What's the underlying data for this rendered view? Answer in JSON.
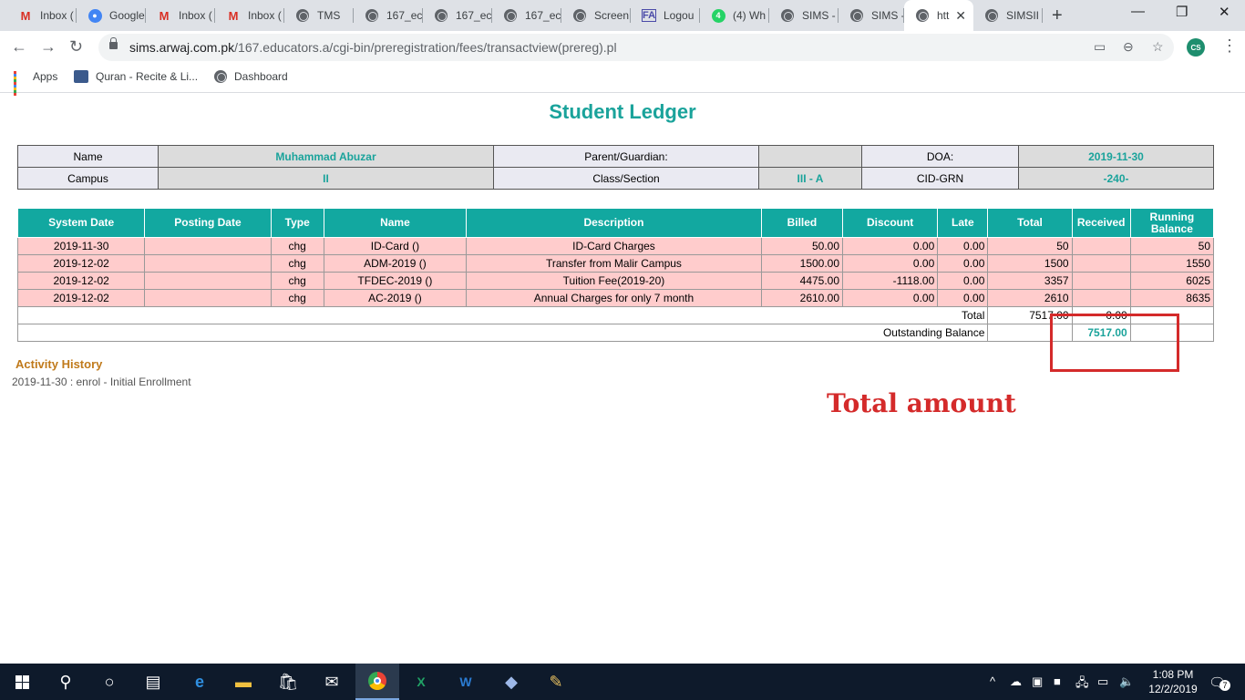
{
  "browser": {
    "tabs": [
      {
        "label": "Inbox (",
        "icon": "gmail-icon"
      },
      {
        "label": "Google",
        "icon": "google-account-icon"
      },
      {
        "label": "Inbox (",
        "icon": "gmail-icon"
      },
      {
        "label": "Inbox (",
        "icon": "gmail-icon"
      },
      {
        "label": "TMS",
        "icon": "globe-icon"
      },
      {
        "label": "167_ec",
        "icon": "globe-icon"
      },
      {
        "label": "167_ec",
        "icon": "globe-icon"
      },
      {
        "label": "167_ec",
        "icon": "globe-icon"
      },
      {
        "label": "Screen",
        "icon": "globe-icon"
      },
      {
        "label": "Logou",
        "icon": "logo-icon"
      },
      {
        "label": "(4) Wh",
        "icon": "whatsapp-icon"
      },
      {
        "label": "SIMS -",
        "icon": "globe-icon"
      },
      {
        "label": "SIMS -",
        "icon": "globe-icon"
      },
      {
        "label": "htt",
        "icon": "globe-icon"
      },
      {
        "label": "SIMSII",
        "icon": "globe-icon"
      }
    ],
    "url_domain": "sims.arwaj.com.pk",
    "url_path": "/167.educators.a/cgi-bin/preregistration/fees/transactview(prereg).pl",
    "profile_initials": "CS",
    "bookmarks": {
      "apps": "Apps",
      "quran": "Quran - Recite & Li...",
      "dashboard": "Dashboard"
    }
  },
  "page": {
    "title": "Student Ledger",
    "info": {
      "name_label": "Name",
      "name_value": "Muhammad Abuzar",
      "parent_label": "Parent/Guardian:",
      "parent_value": "",
      "doa_label": "DOA:",
      "doa_value": "2019-11-30",
      "campus_label": "Campus",
      "campus_value": "II",
      "class_label": "Class/Section",
      "class_value": "III - A",
      "cid_label": "CID-GRN",
      "cid_value": "-240-"
    },
    "ledger": {
      "headers": [
        "System Date",
        "Posting Date",
        "Type",
        "Name",
        "Description",
        "Billed",
        "Discount",
        "Late",
        "Total",
        "Received",
        "Running Balance"
      ],
      "rows": [
        {
          "system_date": "2019-11-30",
          "posting_date": "",
          "type": "chg",
          "name": "ID-Card ()",
          "description": "ID-Card Charges",
          "billed": "50.00",
          "discount": "0.00",
          "late": "0.00",
          "total": "50",
          "received": "",
          "running": "50"
        },
        {
          "system_date": "2019-12-02",
          "posting_date": "",
          "type": "chg",
          "name": "ADM-2019 ()",
          "description": "Transfer from Malir Campus",
          "billed": "1500.00",
          "discount": "0.00",
          "late": "0.00",
          "total": "1500",
          "received": "",
          "running": "1550"
        },
        {
          "system_date": "2019-12-02",
          "posting_date": "",
          "type": "chg",
          "name": "TFDEC-2019 ()",
          "description": "Tuition Fee(2019-20)",
          "billed": "4475.00",
          "discount": "-1118.00",
          "late": "0.00",
          "total": "3357",
          "received": "",
          "running": "6025"
        },
        {
          "system_date": "2019-12-02",
          "posting_date": "",
          "type": "chg",
          "name": "AC-2019 ()",
          "description": "Annual Charges for only 7 month",
          "billed": "2610.00",
          "discount": "0.00",
          "late": "0.00",
          "total": "2610",
          "received": "",
          "running": "8635"
        }
      ],
      "total_label": "Total",
      "total_value": "7517.00",
      "received_total": "0.00",
      "outstanding_label": "Outstanding Balance",
      "outstanding_value": "7517.00"
    },
    "activity": {
      "title": "Activity History",
      "item": "2019-11-30 : enrol - Initial Enrollment"
    },
    "annotation": "Total amount",
    "annotation_color": "#d42a2a",
    "accent_color": "#1aa39b"
  },
  "taskbar": {
    "time": "1:08 PM",
    "date": "12/2/2019",
    "notification_count": "7"
  }
}
